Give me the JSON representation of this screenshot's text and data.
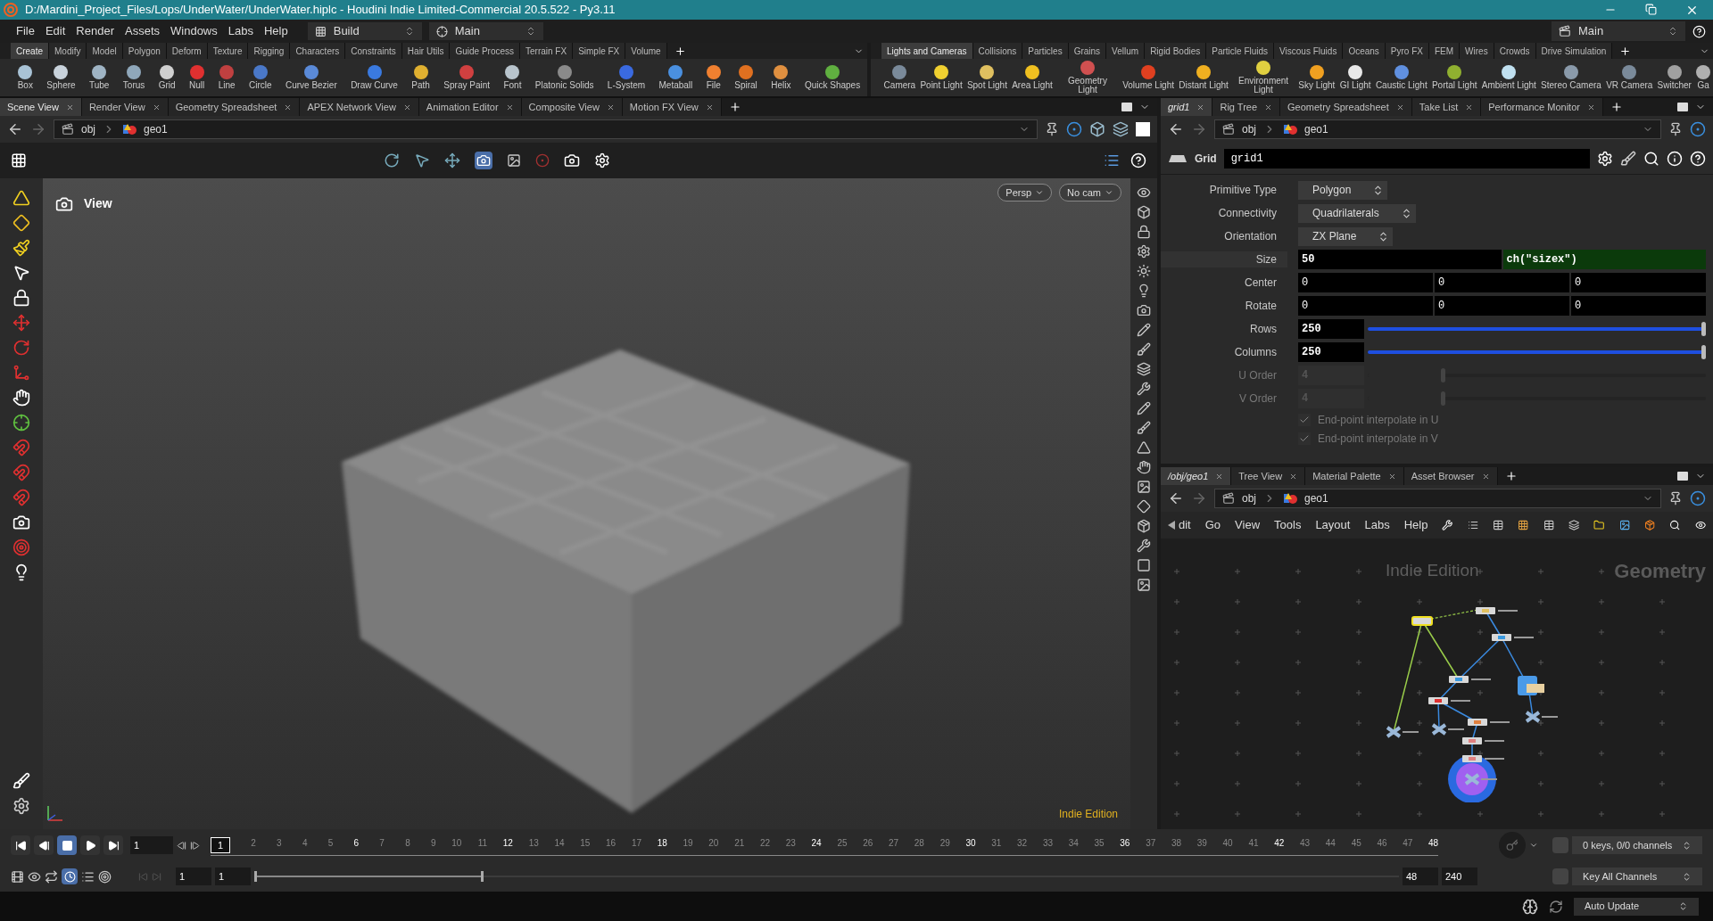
{
  "title_bar": {
    "title": "D:/Mardini_Project_Files/Lops/UnderWater/UnderWater.hiplc - Houdini Indie Limited-Commercial 20.5.522 - Py3.11"
  },
  "menu": [
    "File",
    "Edit",
    "Render",
    "Assets",
    "Windows",
    "Labs",
    "Help"
  ],
  "desktops": [
    {
      "label": "Build"
    },
    {
      "label": "Main"
    }
  ],
  "right_desktop": {
    "label": "Main"
  },
  "shelf_left": {
    "tabs": [
      {
        "label": "Create",
        "selected": true
      },
      {
        "label": "Modify",
        "selected": false
      },
      {
        "label": "Model",
        "selected": false
      },
      {
        "label": "Polygon",
        "selected": false
      },
      {
        "label": "Deform",
        "selected": false
      },
      {
        "label": "Texture",
        "selected": false
      },
      {
        "label": "Rigging",
        "selected": false
      },
      {
        "label": "Characters",
        "selected": false
      },
      {
        "label": "Constraints",
        "selected": false
      },
      {
        "label": "Hair Utils",
        "selected": false
      },
      {
        "label": "Guide Process",
        "selected": false
      },
      {
        "label": "Terrain FX",
        "selected": false
      },
      {
        "label": "Simple FX",
        "selected": false
      },
      {
        "label": "Volume",
        "selected": false
      }
    ],
    "tools": [
      {
        "label": "Box",
        "color": "#a9c3d6"
      },
      {
        "label": "Sphere",
        "color": "#c9d3dc"
      },
      {
        "label": "Tube",
        "color": "#9fb4c4"
      },
      {
        "label": "Torus",
        "color": "#8fa7ba"
      },
      {
        "label": "Grid",
        "color": "#d0d0d0"
      },
      {
        "label": "Null",
        "color": "#e03030"
      },
      {
        "label": "Line",
        "color": "#c04040"
      },
      {
        "label": "Circle",
        "color": "#4a78c8"
      },
      {
        "label": "Curve Bezier",
        "color": "#5a8ad8"
      },
      {
        "label": "Draw Curve",
        "color": "#3a7ae0"
      },
      {
        "label": "Path",
        "color": "#e0b030"
      },
      {
        "label": "Spray Paint",
        "color": "#d04040"
      },
      {
        "label": "Font",
        "color": "#b8c4cc"
      },
      {
        "label": "Platonic Solids",
        "color": "#8a8a8a"
      },
      {
        "label": "L-System",
        "color": "#3a6ae0"
      },
      {
        "label": "Metaball",
        "color": "#4a90e0"
      },
      {
        "label": "File",
        "color": "#f08030"
      },
      {
        "label": "Spiral",
        "color": "#e07020"
      },
      {
        "label": "Helix",
        "color": "#e09040"
      },
      {
        "label": "Quick Shapes",
        "color": "#60b040"
      }
    ]
  },
  "shelf_right": {
    "tabs": [
      {
        "label": "Lights and Cameras",
        "selected": true
      },
      {
        "label": "Collisions",
        "selected": false
      },
      {
        "label": "Particles",
        "selected": false
      },
      {
        "label": "Grains",
        "selected": false
      },
      {
        "label": "Vellum",
        "selected": false
      },
      {
        "label": "Rigid Bodies",
        "selected": false
      },
      {
        "label": "Particle Fluids",
        "selected": false
      },
      {
        "label": "Viscous Fluids",
        "selected": false
      },
      {
        "label": "Oceans",
        "selected": false
      },
      {
        "label": "Pyro FX",
        "selected": false
      },
      {
        "label": "FEM",
        "selected": false
      },
      {
        "label": "Wires",
        "selected": false
      },
      {
        "label": "Crowds",
        "selected": false
      },
      {
        "label": "Drive Simulation",
        "selected": false
      }
    ],
    "tools": [
      {
        "label": "Camera",
        "color": "#7a8a9a"
      },
      {
        "label": "Point Light",
        "color": "#f0d030"
      },
      {
        "label": "Spot Light",
        "color": "#e0c060"
      },
      {
        "label": "Area Light",
        "color": "#f0c020"
      },
      {
        "label": "Geometry Light",
        "color": "#d05050"
      },
      {
        "label": "Volume Light",
        "color": "#e04020"
      },
      {
        "label": "Distant Light",
        "color": "#f0b020"
      },
      {
        "label": "Environment Light",
        "color": "#e0d040"
      },
      {
        "label": "Sky Light",
        "color": "#f0a020"
      },
      {
        "label": "GI Light",
        "color": "#e8e8e8"
      },
      {
        "label": "Caustic Light",
        "color": "#6090e0"
      },
      {
        "label": "Portal Light",
        "color": "#90b030"
      },
      {
        "label": "Ambient Light",
        "color": "#c0e0f0"
      },
      {
        "label": "Stereo Camera",
        "color": "#8a9aaa"
      },
      {
        "label": "VR Camera",
        "color": "#7a8a9a"
      },
      {
        "label": "Switcher",
        "color": "#a0a0a0"
      },
      {
        "label": "Ga",
        "color": "#b0b0b0"
      }
    ]
  },
  "scene_view": {
    "tabs": [
      {
        "label": "Scene View",
        "selected": true
      },
      {
        "label": "Render View",
        "selected": false
      },
      {
        "label": "Geometry Spreadsheet",
        "selected": false
      },
      {
        "label": "APEX Network View",
        "selected": false
      },
      {
        "label": "Animation Editor",
        "selected": false
      },
      {
        "label": "Composite View",
        "selected": false
      },
      {
        "label": "Motion FX View",
        "selected": false
      }
    ],
    "path": [
      "obj",
      "geo1"
    ],
    "view_label": "View",
    "projection": "Persp",
    "camera": "No cam",
    "edition": "Indie Edition"
  },
  "parameters": {
    "tabs": [
      {
        "label": "grid1",
        "selected": true
      },
      {
        "label": "Rig Tree",
        "selected": false
      },
      {
        "label": "Geometry Spreadsheet",
        "selected": false
      },
      {
        "label": "Take List",
        "selected": false
      },
      {
        "label": "Performance Monitor",
        "selected": false
      }
    ],
    "path": [
      "obj",
      "geo1"
    ],
    "node_type": "Grid",
    "node_name": "grid1",
    "params": [
      {
        "kind": "menu",
        "label": "Primitive Type",
        "value": "Polygon"
      },
      {
        "kind": "menu",
        "label": "Connectivity",
        "value": "Quadrilaterals"
      },
      {
        "kind": "menu",
        "label": "Orientation",
        "value": "ZX Plane"
      },
      {
        "kind": "expr",
        "label": "Size",
        "value": "50",
        "expression": "ch(\"sizex\")"
      },
      {
        "kind": "vector",
        "label": "Center",
        "values": [
          "0",
          "0",
          "0"
        ]
      },
      {
        "kind": "vector",
        "label": "Rotate",
        "values": [
          "0",
          "0",
          "0"
        ]
      },
      {
        "kind": "slider",
        "label": "Rows",
        "value": "250",
        "level": 1,
        "disabled": false
      },
      {
        "kind": "slider",
        "label": "Columns",
        "value": "250",
        "level": 1,
        "disabled": false
      },
      {
        "kind": "slider",
        "label": "U Order",
        "value": "4",
        "level": 0.23,
        "disabled": true
      },
      {
        "kind": "slider",
        "label": "V Order",
        "value": "4",
        "level": 0.23,
        "disabled": true
      },
      {
        "kind": "toggle",
        "label": "End-point interpolate in U",
        "checked": true,
        "disabled": true
      },
      {
        "kind": "toggle",
        "label": "End-point interpolate in V",
        "checked": true,
        "disabled": true
      }
    ]
  },
  "network": {
    "tabs": [
      {
        "label": "/obj/geo1",
        "selected": true
      },
      {
        "label": "Tree View",
        "selected": false
      },
      {
        "label": "Material Palette",
        "selected": false
      },
      {
        "label": "Asset Browser",
        "selected": false
      }
    ],
    "path": [
      "obj",
      "geo1"
    ],
    "menu": [
      "dit",
      "Go",
      "View",
      "Tools",
      "Layout",
      "Labs",
      "Help"
    ],
    "edition": "Indie Edition",
    "context": "Geometry"
  },
  "timeline": {
    "frame_field": "1",
    "current_frame": "1",
    "frames": [
      "2",
      "3",
      "4",
      "5",
      "6",
      "7",
      "8",
      "9",
      "10",
      "11",
      "12",
      "13",
      "14",
      "15",
      "16",
      "17",
      "18",
      "19",
      "20",
      "21",
      "22",
      "23",
      "24",
      "25",
      "26",
      "27",
      "28",
      "29",
      "30",
      "31",
      "32",
      "33",
      "34",
      "35",
      "36",
      "37",
      "38",
      "39",
      "40",
      "41",
      "42",
      "43",
      "44",
      "45",
      "46",
      "47",
      "48"
    ],
    "start": "1",
    "range_start": "1",
    "range": {
      "level": 0.2
    },
    "range_end": "48",
    "end": "240",
    "keys": "0 keys, 0/0 channels",
    "key_button": "Key All Channels"
  },
  "status": {
    "update_mode": "Auto Update"
  }
}
